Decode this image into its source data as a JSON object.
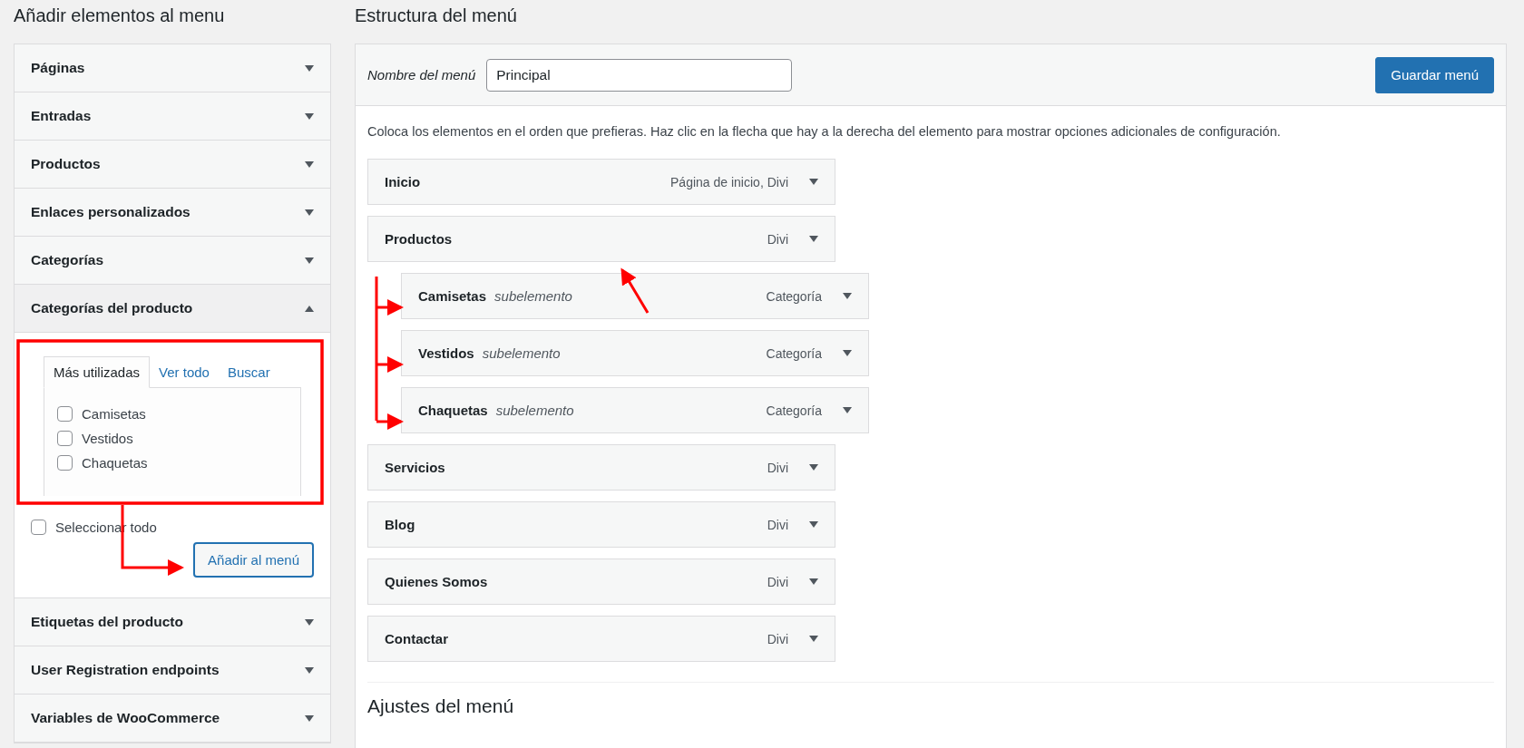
{
  "add_items": {
    "title": "Añadir elementos al menu",
    "sections": [
      {
        "label": "Páginas",
        "expanded": false
      },
      {
        "label": "Entradas",
        "expanded": false
      },
      {
        "label": "Productos",
        "expanded": false
      },
      {
        "label": "Enlaces personalizados",
        "expanded": false
      },
      {
        "label": "Categorías",
        "expanded": false
      },
      {
        "label": "Categorías del producto",
        "expanded": true
      },
      {
        "label": "Etiquetas del producto",
        "expanded": false
      },
      {
        "label": "User Registration endpoints",
        "expanded": false
      },
      {
        "label": "Variables de WooCommerce",
        "expanded": false
      }
    ],
    "open_panel": {
      "tabs": [
        {
          "label": "Más utilizadas",
          "selected": true
        },
        {
          "label": "Ver todo",
          "selected": false
        },
        {
          "label": "Buscar",
          "selected": false
        }
      ],
      "options": [
        {
          "label": "Camisetas",
          "checked": false
        },
        {
          "label": "Vestidos",
          "checked": false
        },
        {
          "label": "Chaquetas",
          "checked": false
        }
      ],
      "select_all": {
        "label": "Seleccionar todo",
        "checked": false
      },
      "add_button": "Añadir al menú"
    }
  },
  "structure": {
    "title": "Estructura del menú",
    "name_label": "Nombre del menú",
    "name_value": "Principal",
    "save_button": "Guardar menú",
    "instructions": "Coloca los elementos en el orden que prefieras. Haz clic en la flecha que hay a la derecha del elemento para mostrar opciones adicionales de configuración.",
    "items": [
      {
        "title": "Inicio",
        "type": "Página de inicio, Divi"
      },
      {
        "title": "Productos",
        "type": "Divi",
        "children": [
          {
            "title": "Camisetas",
            "note": "subelemento",
            "type": "Categoría"
          },
          {
            "title": "Vestidos",
            "note": "subelemento",
            "type": "Categoría"
          },
          {
            "title": "Chaquetas",
            "note": "subelemento",
            "type": "Categoría"
          }
        ]
      },
      {
        "title": "Servicios",
        "type": "Divi"
      },
      {
        "title": "Blog",
        "type": "Divi"
      },
      {
        "title": "Quienes Somos",
        "type": "Divi"
      },
      {
        "title": "Contactar",
        "type": "Divi"
      }
    ],
    "settings_title": "Ajustes del menú"
  }
}
